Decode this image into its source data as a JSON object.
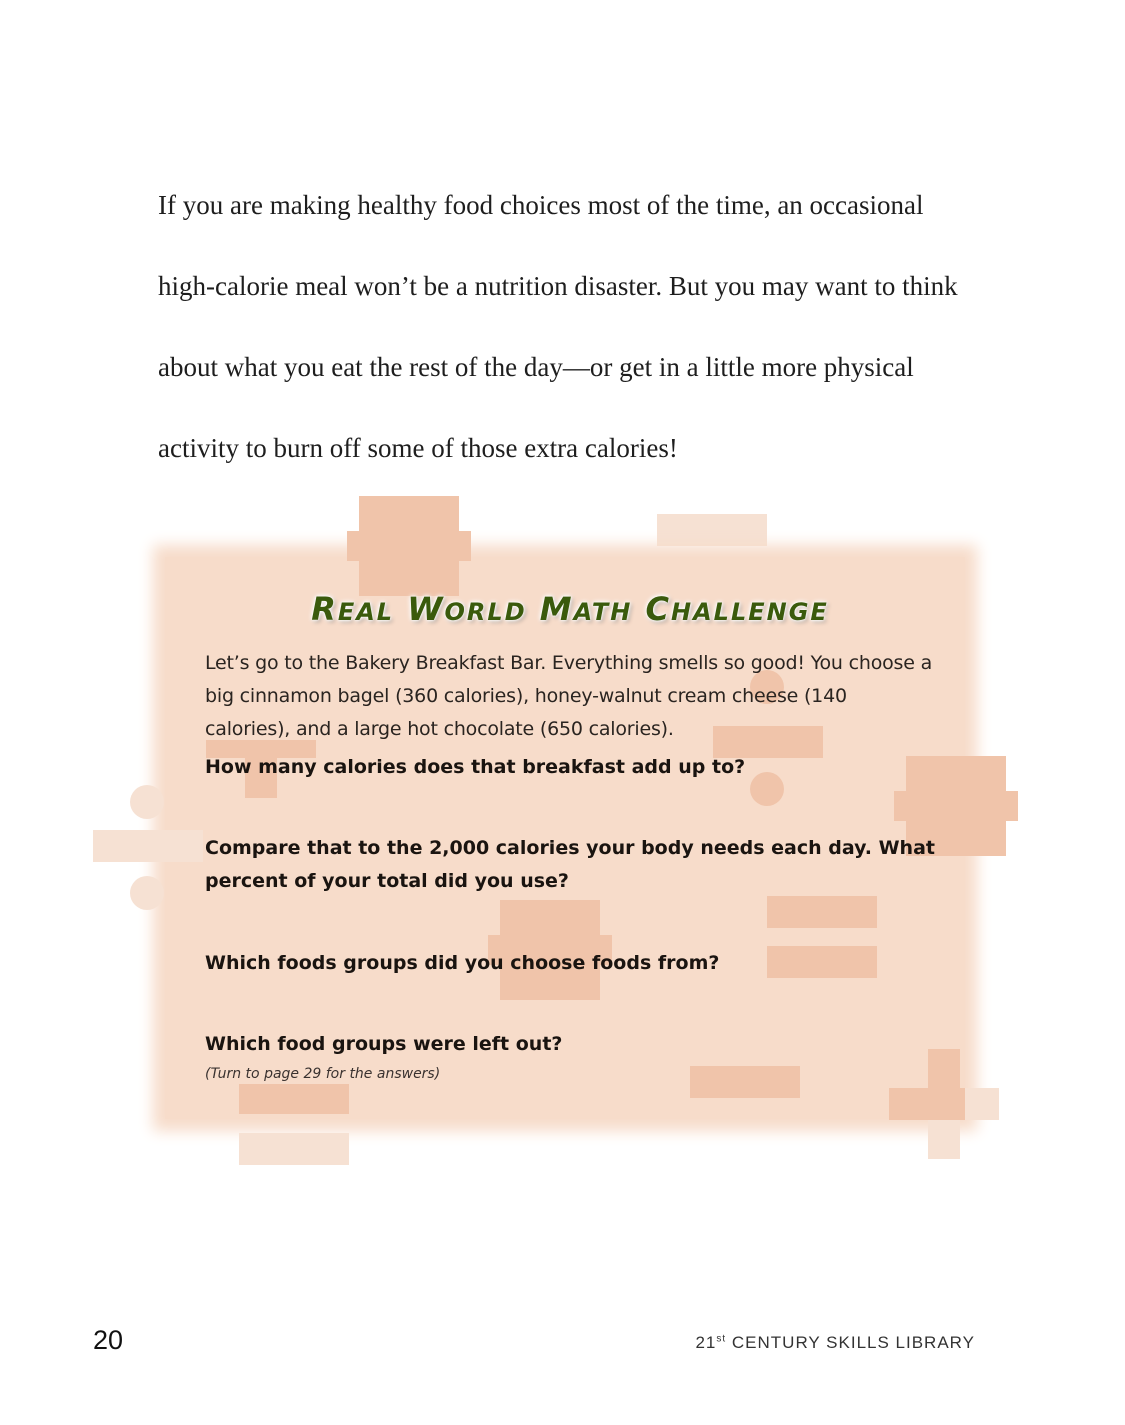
{
  "body_text": [
    "If you are making healthy food choices most of the time, an occasional",
    "high-calorie meal won’t be a nutrition disaster. But you may want to think",
    "about what you eat the rest of the day—or get in a little more physical",
    "activity to burn off some of those extra calories!"
  ],
  "challenge": {
    "title_parts": [
      {
        "cap": "R",
        "rest": "EAL"
      },
      {
        "cap": "W",
        "rest": "ORLD"
      },
      {
        "cap": "M",
        "rest": "ATH"
      },
      {
        "cap": "C",
        "rest": "HALLENGE"
      }
    ],
    "intro": "Let’s go to the Bakery Breakfast Bar. Everything smells so good! You choose a big cinnamon bagel (360 calories), honey-walnut cream cheese (140 calories), and a large hot chocolate (650 calories).",
    "questions": [
      "How many calories does that breakfast add up to?",
      "Compare that to the 2,000 calories your body needs each day. What percent of your total did you use?",
      "Which foods groups did you choose foods from?",
      "Which food groups were left out?"
    ],
    "note": "(Turn to page 29 for the answers)"
  },
  "footer": {
    "page_number": "20",
    "series_prefix": "21",
    "series_sup": "st",
    "series_rest": " CENTURY SKILLS LIBRARY"
  },
  "colors": {
    "box_background": "#f7dcca",
    "symbol_light": "#f6e1d3",
    "symbol_medium": "#f0c4aa",
    "title_green": "#3a5a0c"
  },
  "decorative_symbols": [
    "times-icon",
    "minus-icon",
    "divide-icon",
    "equals-icon",
    "plus-icon"
  ]
}
